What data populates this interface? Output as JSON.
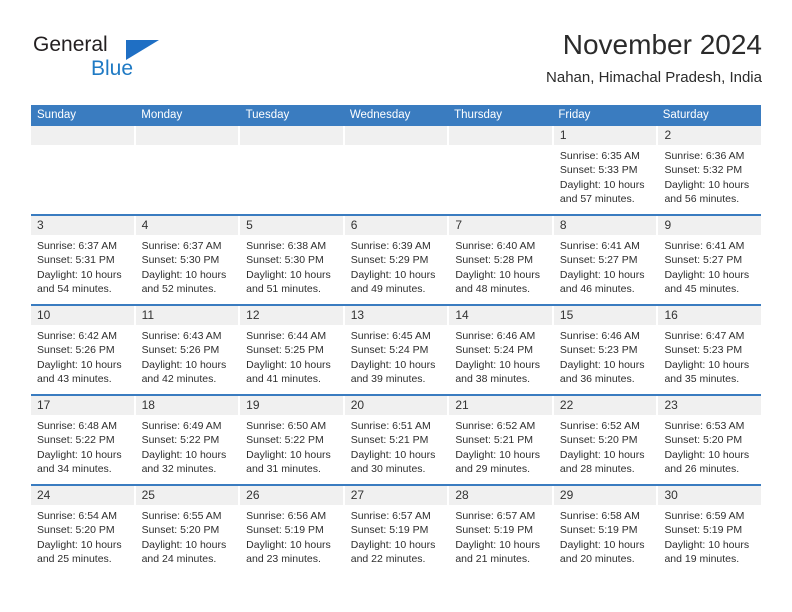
{
  "brand": {
    "name_top": "General",
    "name_bottom": "Blue",
    "triangle_icon": "blue-triangle-icon",
    "color_dark": "#231f20",
    "color_blue": "#1f7ac4"
  },
  "header": {
    "title": "November 2024",
    "subtitle": "Nahan, Himachal Pradesh, India"
  },
  "theme": {
    "header_bg": "#3a7cc0",
    "header_text": "#ffffff",
    "daynum_bg": "#f0f0f0",
    "cell_bg": "#ffffff"
  },
  "calendar": {
    "weekdays": [
      "Sunday",
      "Monday",
      "Tuesday",
      "Wednesday",
      "Thursday",
      "Friday",
      "Saturday"
    ],
    "weeks": [
      [
        {
          "day": "",
          "lines": []
        },
        {
          "day": "",
          "lines": []
        },
        {
          "day": "",
          "lines": []
        },
        {
          "day": "",
          "lines": []
        },
        {
          "day": "",
          "lines": []
        },
        {
          "day": "1",
          "lines": [
            "Sunrise: 6:35 AM",
            "Sunset: 5:33 PM",
            "Daylight: 10 hours and 57 minutes."
          ]
        },
        {
          "day": "2",
          "lines": [
            "Sunrise: 6:36 AM",
            "Sunset: 5:32 PM",
            "Daylight: 10 hours and 56 minutes."
          ]
        }
      ],
      [
        {
          "day": "3",
          "lines": [
            "Sunrise: 6:37 AM",
            "Sunset: 5:31 PM",
            "Daylight: 10 hours and 54 minutes."
          ]
        },
        {
          "day": "4",
          "lines": [
            "Sunrise: 6:37 AM",
            "Sunset: 5:30 PM",
            "Daylight: 10 hours and 52 minutes."
          ]
        },
        {
          "day": "5",
          "lines": [
            "Sunrise: 6:38 AM",
            "Sunset: 5:30 PM",
            "Daylight: 10 hours and 51 minutes."
          ]
        },
        {
          "day": "6",
          "lines": [
            "Sunrise: 6:39 AM",
            "Sunset: 5:29 PM",
            "Daylight: 10 hours and 49 minutes."
          ]
        },
        {
          "day": "7",
          "lines": [
            "Sunrise: 6:40 AM",
            "Sunset: 5:28 PM",
            "Daylight: 10 hours and 48 minutes."
          ]
        },
        {
          "day": "8",
          "lines": [
            "Sunrise: 6:41 AM",
            "Sunset: 5:27 PM",
            "Daylight: 10 hours and 46 minutes."
          ]
        },
        {
          "day": "9",
          "lines": [
            "Sunrise: 6:41 AM",
            "Sunset: 5:27 PM",
            "Daylight: 10 hours and 45 minutes."
          ]
        }
      ],
      [
        {
          "day": "10",
          "lines": [
            "Sunrise: 6:42 AM",
            "Sunset: 5:26 PM",
            "Daylight: 10 hours and 43 minutes."
          ]
        },
        {
          "day": "11",
          "lines": [
            "Sunrise: 6:43 AM",
            "Sunset: 5:26 PM",
            "Daylight: 10 hours and 42 minutes."
          ]
        },
        {
          "day": "12",
          "lines": [
            "Sunrise: 6:44 AM",
            "Sunset: 5:25 PM",
            "Daylight: 10 hours and 41 minutes."
          ]
        },
        {
          "day": "13",
          "lines": [
            "Sunrise: 6:45 AM",
            "Sunset: 5:24 PM",
            "Daylight: 10 hours and 39 minutes."
          ]
        },
        {
          "day": "14",
          "lines": [
            "Sunrise: 6:46 AM",
            "Sunset: 5:24 PM",
            "Daylight: 10 hours and 38 minutes."
          ]
        },
        {
          "day": "15",
          "lines": [
            "Sunrise: 6:46 AM",
            "Sunset: 5:23 PM",
            "Daylight: 10 hours and 36 minutes."
          ]
        },
        {
          "day": "16",
          "lines": [
            "Sunrise: 6:47 AM",
            "Sunset: 5:23 PM",
            "Daylight: 10 hours and 35 minutes."
          ]
        }
      ],
      [
        {
          "day": "17",
          "lines": [
            "Sunrise: 6:48 AM",
            "Sunset: 5:22 PM",
            "Daylight: 10 hours and 34 minutes."
          ]
        },
        {
          "day": "18",
          "lines": [
            "Sunrise: 6:49 AM",
            "Sunset: 5:22 PM",
            "Daylight: 10 hours and 32 minutes."
          ]
        },
        {
          "day": "19",
          "lines": [
            "Sunrise: 6:50 AM",
            "Sunset: 5:22 PM",
            "Daylight: 10 hours and 31 minutes."
          ]
        },
        {
          "day": "20",
          "lines": [
            "Sunrise: 6:51 AM",
            "Sunset: 5:21 PM",
            "Daylight: 10 hours and 30 minutes."
          ]
        },
        {
          "day": "21",
          "lines": [
            "Sunrise: 6:52 AM",
            "Sunset: 5:21 PM",
            "Daylight: 10 hours and 29 minutes."
          ]
        },
        {
          "day": "22",
          "lines": [
            "Sunrise: 6:52 AM",
            "Sunset: 5:20 PM",
            "Daylight: 10 hours and 28 minutes."
          ]
        },
        {
          "day": "23",
          "lines": [
            "Sunrise: 6:53 AM",
            "Sunset: 5:20 PM",
            "Daylight: 10 hours and 26 minutes."
          ]
        }
      ],
      [
        {
          "day": "24",
          "lines": [
            "Sunrise: 6:54 AM",
            "Sunset: 5:20 PM",
            "Daylight: 10 hours and 25 minutes."
          ]
        },
        {
          "day": "25",
          "lines": [
            "Sunrise: 6:55 AM",
            "Sunset: 5:20 PM",
            "Daylight: 10 hours and 24 minutes."
          ]
        },
        {
          "day": "26",
          "lines": [
            "Sunrise: 6:56 AM",
            "Sunset: 5:19 PM",
            "Daylight: 10 hours and 23 minutes."
          ]
        },
        {
          "day": "27",
          "lines": [
            "Sunrise: 6:57 AM",
            "Sunset: 5:19 PM",
            "Daylight: 10 hours and 22 minutes."
          ]
        },
        {
          "day": "28",
          "lines": [
            "Sunrise: 6:57 AM",
            "Sunset: 5:19 PM",
            "Daylight: 10 hours and 21 minutes."
          ]
        },
        {
          "day": "29",
          "lines": [
            "Sunrise: 6:58 AM",
            "Sunset: 5:19 PM",
            "Daylight: 10 hours and 20 minutes."
          ]
        },
        {
          "day": "30",
          "lines": [
            "Sunrise: 6:59 AM",
            "Sunset: 5:19 PM",
            "Daylight: 10 hours and 19 minutes."
          ]
        }
      ]
    ]
  }
}
